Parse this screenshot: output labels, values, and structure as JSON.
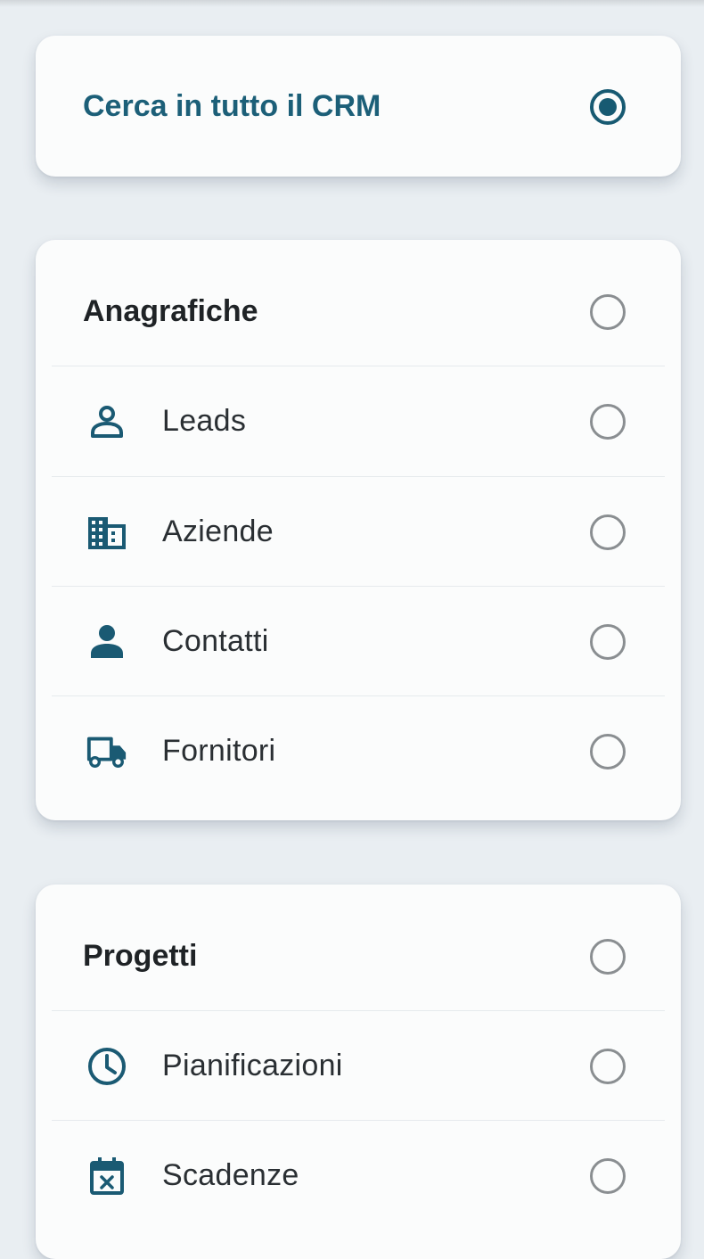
{
  "colors": {
    "accent": "#175a72",
    "icon": "#1a5a73",
    "background": "#e9eef2",
    "card": "#fbfcfc",
    "radio_off": "#8a8e91"
  },
  "global_option": {
    "label": "Cerca in tutto il CRM",
    "selected": true
  },
  "sections": [
    {
      "title": "Anagrafiche",
      "selected": false,
      "items": [
        {
          "label": "Leads",
          "icon": "person-outline-icon",
          "selected": false
        },
        {
          "label": "Aziende",
          "icon": "building-icon",
          "selected": false
        },
        {
          "label": "Contatti",
          "icon": "person-icon",
          "selected": false
        },
        {
          "label": "Fornitori",
          "icon": "truck-icon",
          "selected": false
        }
      ]
    },
    {
      "title": "Progetti",
      "selected": false,
      "items": [
        {
          "label": "Pianificazioni",
          "icon": "clock-icon",
          "selected": false
        },
        {
          "label": "Scadenze",
          "icon": "calendar-cancel-icon",
          "selected": false
        }
      ]
    }
  ]
}
